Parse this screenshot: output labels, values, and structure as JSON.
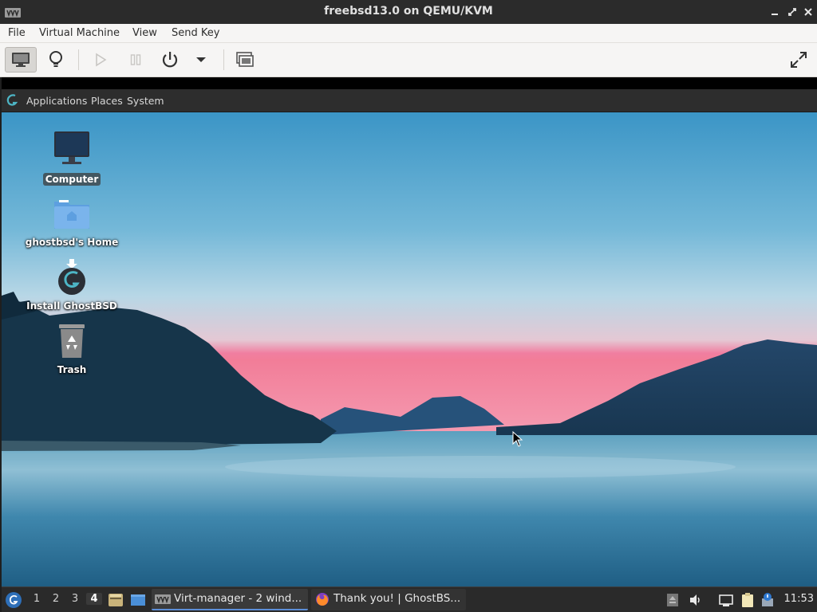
{
  "window": {
    "title": "freebsd13.0 on QEMU/KVM",
    "app_icon": "virt-manager-icon",
    "controls": [
      "minimize-icon",
      "restore-icon",
      "close-icon"
    ]
  },
  "menu": {
    "file": "File",
    "virtual_machine": "Virtual Machine",
    "view": "View",
    "send_key": "Send Key"
  },
  "toolbar": {
    "buttons": [
      "console-icon",
      "details-lightbulb-icon",
      "run-icon",
      "pause-icon",
      "power-icon",
      "power-menu-chevron-icon",
      "snapshots-icon",
      "fullscreen-icon"
    ]
  },
  "guest_panel": {
    "logo": "ghostbsd-logo-icon",
    "applications": "Applications",
    "places": "Places",
    "system": "System"
  },
  "desktop_icons": {
    "computer": "Computer",
    "home": "ghostbsd's Home",
    "install": "Install GhostBSD",
    "trash": "Trash"
  },
  "taskbar": {
    "workspaces": [
      "1",
      "2",
      "3",
      "4"
    ],
    "current_workspace": "4",
    "tasks": {
      "virt_manager": "Virt-manager - 2 wind...",
      "firefox": "Thank you! | GhostBS..."
    },
    "clock": "11:53"
  },
  "colors": {
    "host_titlebar": "#2b2b2b",
    "guest_panel": "#2d2d2d",
    "sky_top": "#3f9ccd",
    "sky_horizon": "#f07ea0",
    "water": "#3e8fb3"
  }
}
